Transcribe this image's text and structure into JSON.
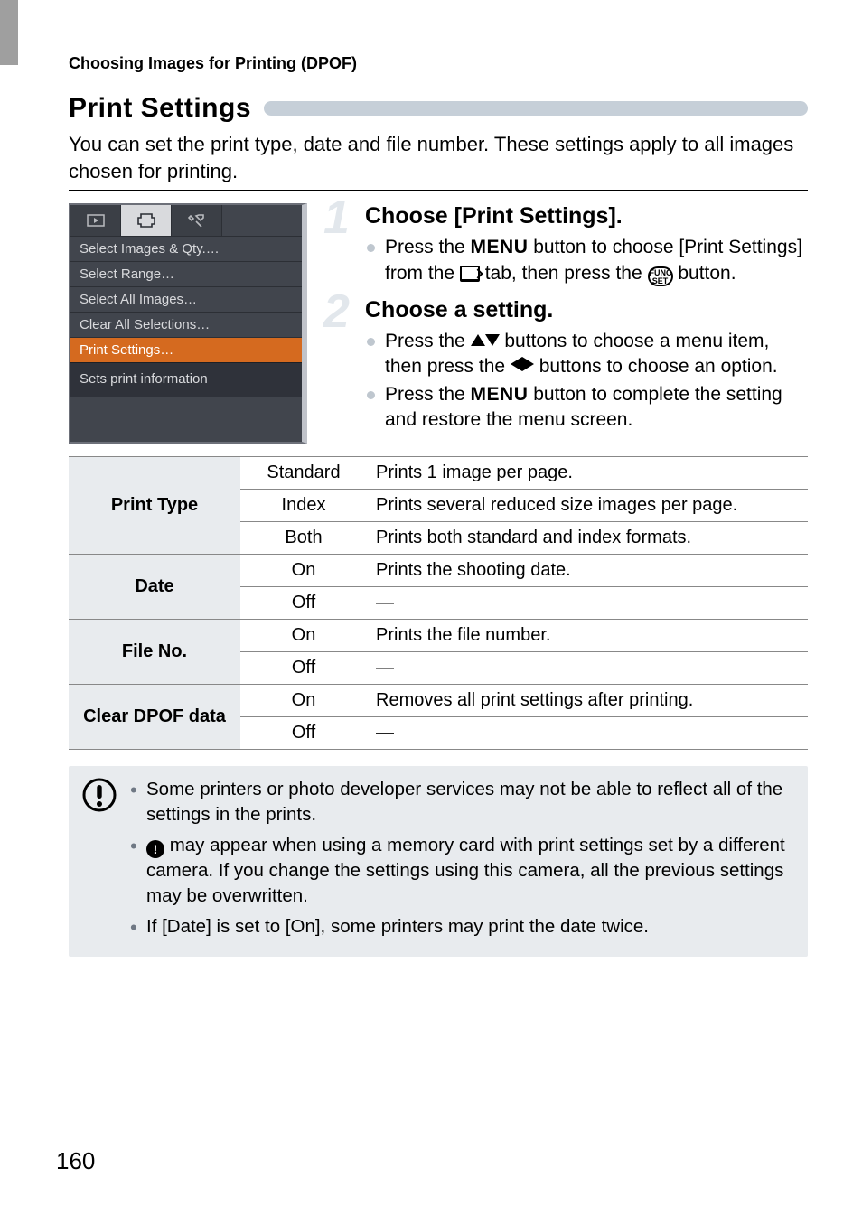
{
  "crumb": "Choosing Images for Printing (DPOF)",
  "h1": "Print Settings",
  "intro": "You can set the print type, date and file number. These settings apply to all images chosen for printing.",
  "menu_screenshot": {
    "tabs": [
      "▶",
      "⎙",
      "🔧"
    ],
    "items": [
      "Select Images & Qty.…",
      "Select Range…",
      "Select All Images…",
      "Clear All Selections…",
      "Print Settings…"
    ],
    "selected_index": 4,
    "footer": "Sets print information"
  },
  "steps": [
    {
      "num": "1",
      "title": "Choose [Print Settings].",
      "bullets": [
        {
          "pre": "Press the ",
          "icon": "MENU",
          "mid": " button to choose [Print Settings] from the ",
          "icon2": "printtab",
          "mid2": " tab, then press the ",
          "icon3": "funcset",
          "post": " button."
        }
      ]
    },
    {
      "num": "2",
      "title": "Choose a setting.",
      "bullets": [
        {
          "pre": "Press the ",
          "icon": "updown",
          "mid": " buttons to choose a menu item, then press the ",
          "icon2": "leftright",
          "post": " buttons to choose an option."
        },
        {
          "pre": "Press the ",
          "icon": "MENU",
          "post": " button to complete the setting and restore the menu screen."
        }
      ]
    }
  ],
  "table": [
    {
      "header": "Print Type",
      "rows": [
        {
          "opt": "Standard",
          "desc": "Prints 1 image per page."
        },
        {
          "opt": "Index",
          "desc": "Prints several reduced size images per page."
        },
        {
          "opt": "Both",
          "desc": "Prints both standard and index formats."
        }
      ]
    },
    {
      "header": "Date",
      "rows": [
        {
          "opt": "On",
          "desc": "Prints the shooting date."
        },
        {
          "opt": "Off",
          "desc": "—"
        }
      ]
    },
    {
      "header": "File No.",
      "rows": [
        {
          "opt": "On",
          "desc": "Prints the file number."
        },
        {
          "opt": "Off",
          "desc": "—"
        }
      ]
    },
    {
      "header": "Clear DPOF data",
      "rows": [
        {
          "opt": "On",
          "desc": "Removes all print settings after printing."
        },
        {
          "opt": "Off",
          "desc": "—"
        }
      ]
    }
  ],
  "notes": [
    "Some printers or photo developer services may not be able to reflect all of the settings in the prints.",
    "__BANG__ may appear when using a memory card with print settings set by a different camera. If you change the settings using this camera, all the previous settings may be overwritten.",
    "If [Date] is set to [On], some printers may print the date twice."
  ],
  "page_number": "160"
}
